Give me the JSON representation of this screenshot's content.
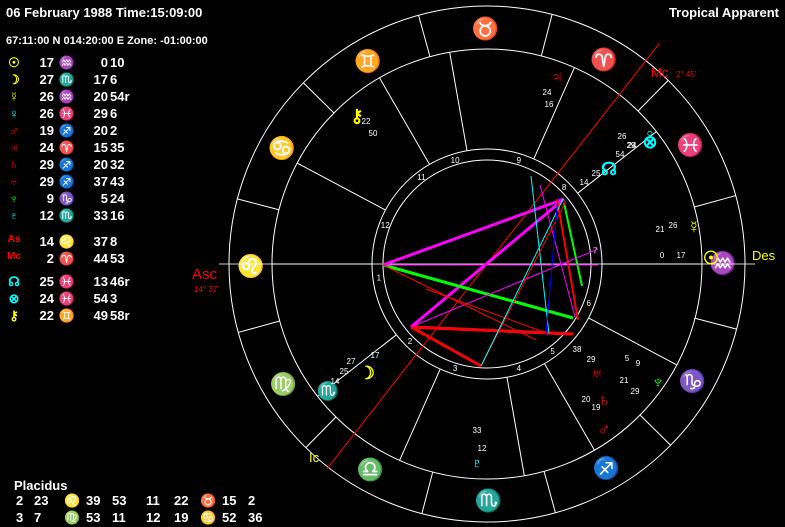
{
  "header": {
    "date_time": "06 February 1988   Time:15:09:00",
    "location": "67:11:00 N 014:20:00 E  Zone: -01:00:00",
    "mode": "Tropical Apparent"
  },
  "colors": {
    "yellow": "#ffff00",
    "green": "#00ff00",
    "cyan": "#00ffff",
    "red": "#ff0000",
    "magenta": "#ff00ff",
    "white": "#ffffff"
  },
  "positions": [
    {
      "planet": "☉",
      "planet_icon": "sun-icon",
      "deg": "17",
      "sign": "♒",
      "sign_icon": "aquarius-icon",
      "min": "0",
      "sec": "10",
      "pcolor": "#ffff00",
      "scolor": "#ffff00"
    },
    {
      "planet": "☽",
      "planet_icon": "moon-icon",
      "deg": "27",
      "sign": "♏",
      "sign_icon": "scorpio-icon",
      "min": "17",
      "sec": "6",
      "pcolor": "#ffff00",
      "scolor": "#00ff00"
    },
    {
      "planet": "☿",
      "planet_icon": "mercury-icon",
      "deg": "26",
      "sign": "♒",
      "sign_icon": "aquarius-icon",
      "min": "20",
      "sec": "54r",
      "pcolor": "#ffff00",
      "scolor": "#ffff00"
    },
    {
      "planet": "♀",
      "planet_icon": "venus-icon",
      "deg": "26",
      "sign": "♓",
      "sign_icon": "pisces-icon",
      "min": "29",
      "sec": "6",
      "pcolor": "#00ffff",
      "scolor": "#00ffff"
    },
    {
      "planet": "♂",
      "planet_icon": "mars-icon",
      "deg": "19",
      "sign": "♐",
      "sign_icon": "sagittarius-icon",
      "min": "20",
      "sec": "2",
      "pcolor": "#ff0000",
      "scolor": "#ff0000"
    },
    {
      "planet": "♃",
      "planet_icon": "jupiter-icon",
      "deg": "24",
      "sign": "♈",
      "sign_icon": "aries-icon",
      "min": "15",
      "sec": "35",
      "pcolor": "#ff0000",
      "scolor": "#ff0000"
    },
    {
      "planet": "♄",
      "planet_icon": "saturn-icon",
      "deg": "29",
      "sign": "♐",
      "sign_icon": "sagittarius-icon",
      "min": "20",
      "sec": "32",
      "pcolor": "#ff0000",
      "scolor": "#ff0000"
    },
    {
      "planet": "♅",
      "planet_icon": "uranus-icon",
      "deg": "29",
      "sign": "♐",
      "sign_icon": "sagittarius-icon",
      "min": "37",
      "sec": "43",
      "pcolor": "#ff0000",
      "scolor": "#ff0000"
    },
    {
      "planet": "♆",
      "planet_icon": "neptune-icon",
      "deg": "9",
      "sign": "♑",
      "sign_icon": "capricorn-icon",
      "min": "5",
      "sec": "24",
      "pcolor": "#00ff00",
      "scolor": "#00ff00"
    },
    {
      "planet": "♇",
      "planet_icon": "pluto-icon",
      "deg": "12",
      "sign": "♏",
      "sign_icon": "scorpio-icon",
      "min": "33",
      "sec": "16",
      "pcolor": "#00ffff",
      "scolor": "#00ffff"
    },
    {
      "planet": "As",
      "planet_icon": "ascendant-label",
      "deg": "14",
      "sign": "♌",
      "sign_icon": "leo-icon",
      "min": "37",
      "sec": "8",
      "pcolor": "#ff0000",
      "scolor": "#ff0000"
    },
    {
      "planet": "Mc",
      "planet_icon": "midheaven-label",
      "deg": "2",
      "sign": "♈",
      "sign_icon": "aries-icon",
      "min": "44",
      "sec": "53",
      "pcolor": "#ff0000",
      "scolor": "#ff0000"
    },
    {
      "planet": "☊",
      "planet_icon": "north-node-icon",
      "deg": "25",
      "sign": "♓",
      "sign_icon": "pisces-icon",
      "min": "13",
      "sec": "46r",
      "pcolor": "#00ffff",
      "scolor": "#00ffff"
    },
    {
      "planet": "⊗",
      "planet_icon": "part-of-fortune-icon",
      "deg": "24",
      "sign": "♓",
      "sign_icon": "pisces-icon",
      "min": "54",
      "sec": "3",
      "pcolor": "#00ffff",
      "scolor": "#00ffff"
    },
    {
      "planet": "⚷",
      "planet_icon": "chiron-icon",
      "deg": "22",
      "sign": "♊",
      "sign_icon": "gemini-icon",
      "min": "49",
      "sec": "58r",
      "pcolor": "#ffff00",
      "scolor": "#ffff00"
    }
  ],
  "placidus": {
    "title": "Placidus",
    "rows": [
      [
        {
          "t": "2",
          "c": "#ffffff"
        },
        {
          "t": "23",
          "c": "#ffffff"
        },
        {
          "t": "♌",
          "c": "#ff0000"
        },
        {
          "t": "39",
          "c": "#ffffff"
        },
        {
          "t": "53",
          "c": "#ffffff"
        },
        {
          "t": "11",
          "c": "#ffffff"
        },
        {
          "t": "22",
          "c": "#ffffff"
        },
        {
          "t": "♉",
          "c": "#00ff00"
        },
        {
          "t": "15",
          "c": "#ffffff"
        },
        {
          "t": "2",
          "c": "#ffffff"
        }
      ],
      [
        {
          "t": "3",
          "c": "#ffffff"
        },
        {
          "t": "7",
          "c": "#ffffff"
        },
        {
          "t": "♍",
          "c": "#00ff00"
        },
        {
          "t": "53",
          "c": "#ffffff"
        },
        {
          "t": "11",
          "c": "#ffffff"
        },
        {
          "t": "12",
          "c": "#ffffff"
        },
        {
          "t": "19",
          "c": "#ffffff"
        },
        {
          "t": "♋",
          "c": "#00ffff"
        },
        {
          "t": "52",
          "c": "#ffffff"
        },
        {
          "t": "36",
          "c": "#ffffff"
        }
      ]
    ]
  },
  "wheel": {
    "signs": [
      {
        "glyph": "♉",
        "icon": "taurus-icon",
        "color": "#00ff00"
      },
      {
        "glyph": "♈",
        "icon": "aries-icon",
        "color": "#ff0000"
      },
      {
        "glyph": "♓",
        "icon": "pisces-icon",
        "color": "#00ffff"
      },
      {
        "glyph": "♒",
        "icon": "aquarius-icon",
        "color": "#ffff00"
      },
      {
        "glyph": "♑",
        "icon": "capricorn-icon",
        "color": "#00ff00"
      },
      {
        "glyph": "♐",
        "icon": "sagittarius-icon",
        "color": "#ff0000"
      },
      {
        "glyph": "♏",
        "icon": "scorpio-icon",
        "color": "#00ffff"
      },
      {
        "glyph": "♎",
        "icon": "libra-icon",
        "color": "#ffff00"
      },
      {
        "glyph": "♍",
        "icon": "virgo-icon",
        "color": "#00ff00"
      },
      {
        "glyph": "♌",
        "icon": "leo-icon",
        "color": "#ff0000"
      },
      {
        "glyph": "♋",
        "icon": "cancer-icon",
        "color": "#00ffff"
      },
      {
        "glyph": "♊",
        "icon": "gemini-icon",
        "color": "#ffff00"
      }
    ],
    "house_numbers": [
      "1",
      "2",
      "3",
      "4",
      "5",
      "6",
      "7",
      "8",
      "9",
      "10",
      "11",
      "12"
    ],
    "axes": {
      "asc": "Asc",
      "asc_deg": "14° 37'",
      "des": "Des",
      "mc": "Mc",
      "mc_deg": "2° 45'",
      "ic": "Ic"
    },
    "planets": [
      {
        "glyph": "♃",
        "icon": "jupiter-icon",
        "color": "#ff0000",
        "d1": "24",
        "d2": "16"
      },
      {
        "glyph": "⚷",
        "icon": "chiron-icon",
        "color": "#ffff00",
        "d1": "22",
        "d2": "50"
      },
      {
        "glyph": "♀",
        "icon": "venus-icon",
        "color": "#00ffff",
        "d1": "26",
        "d2": "29"
      },
      {
        "glyph": "⊗",
        "icon": "part-of-fortune-icon",
        "color": "#00ffff",
        "d1": "24",
        "d2": "54"
      },
      {
        "glyph": "☊",
        "icon": "north-node-icon",
        "color": "#00ffff",
        "d1": "25",
        "d2": "14"
      },
      {
        "glyph": "☿",
        "icon": "mercury-icon",
        "color": "#ffff00",
        "d1": "26",
        "d2": "21"
      },
      {
        "glyph": "☉",
        "icon": "sun-icon",
        "color": "#ffff00",
        "d1": "17",
        "d2": "0"
      },
      {
        "glyph": "♅",
        "icon": "uranus-icon",
        "color": "#ff0000",
        "d1": "29",
        "d2": "38"
      },
      {
        "glyph": "♆",
        "icon": "neptune-icon",
        "color": "#00ff00",
        "d1": "9",
        "d2": "5"
      },
      {
        "glyph": "♄",
        "icon": "saturn-icon",
        "color": "#ff0000",
        "d1": "29",
        "d2": "21"
      },
      {
        "glyph": "♂",
        "icon": "mars-icon",
        "color": "#ff0000",
        "d1": "19",
        "d2": "20"
      },
      {
        "glyph": "♇",
        "icon": "pluto-icon",
        "color": "#00ffff",
        "d1": "12",
        "d2": "33"
      },
      {
        "glyph": "☽",
        "icon": "moon-icon",
        "color": "#ffff00",
        "d1": "27",
        "d2": "17"
      },
      {
        "glyph": "♏",
        "icon": "moon-sign-label",
        "color": "#00ff00",
        "d1": "25",
        "d2": "14"
      }
    ]
  }
}
